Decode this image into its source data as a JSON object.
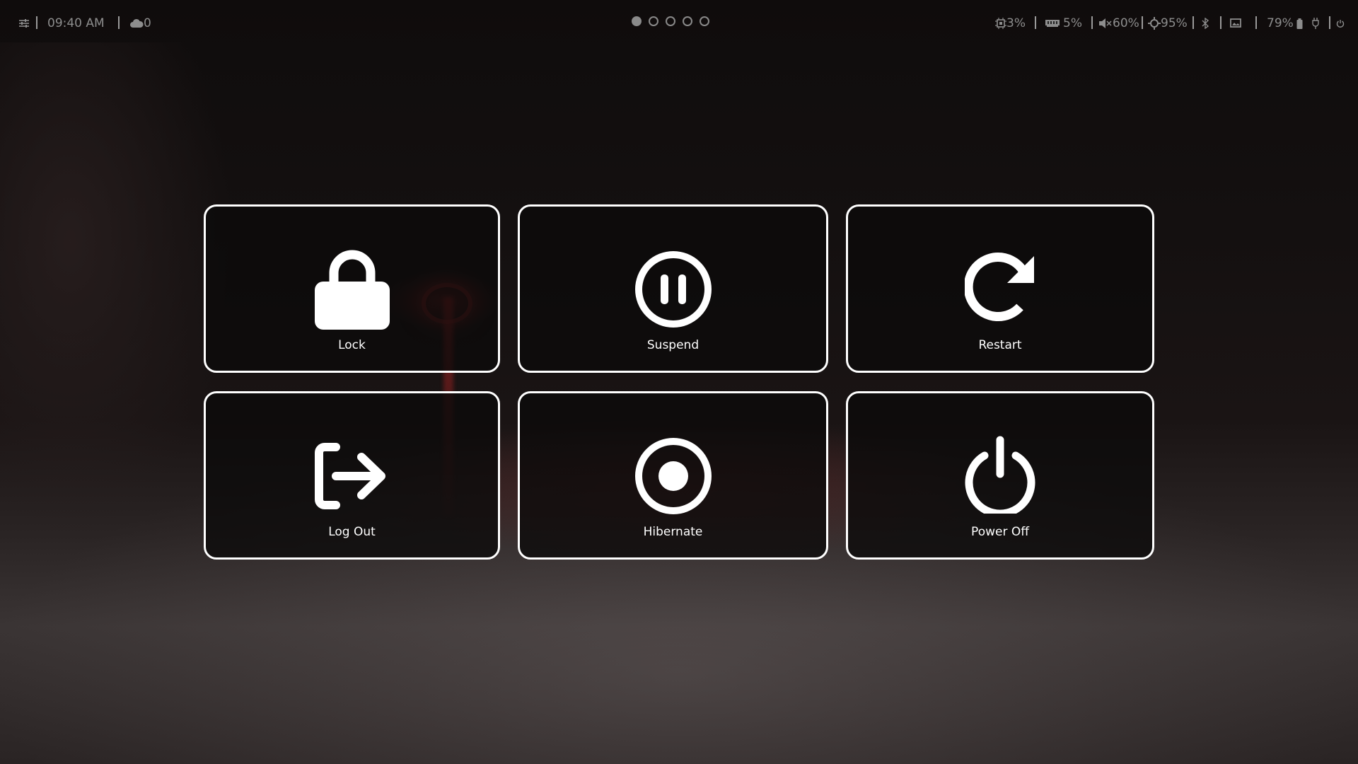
{
  "topbar": {
    "menu_icon": "sliders-icon",
    "time": "09:40 AM",
    "weather_icon": "cloud-icon",
    "weather_value": "0",
    "workspaces": [
      {
        "active": true
      },
      {
        "active": false
      },
      {
        "active": false
      },
      {
        "active": false
      },
      {
        "active": false
      }
    ],
    "cpu_icon": "cpu-icon",
    "cpu": "3%",
    "ram_icon": "memory-icon",
    "ram": "5%",
    "volume_icon": "volume-muted-icon",
    "volume": "60%",
    "brightness_icon": "brightness-icon",
    "brightness": "95%",
    "bluetooth_icon": "bluetooth-icon",
    "screenshot_icon": "screen-icon",
    "battery": "79%",
    "battery_icon": "battery-icon",
    "plug_icon": "plug-icon",
    "power_icon": "power-icon"
  },
  "actions": {
    "lock": {
      "label": "Lock",
      "icon": "lock-icon"
    },
    "suspend": {
      "label": "Suspend",
      "icon": "pause-circle-icon"
    },
    "restart": {
      "label": "Restart",
      "icon": "restart-icon"
    },
    "logout": {
      "label": "Log Out",
      "icon": "logout-icon"
    },
    "hibernate": {
      "label": "Hibernate",
      "icon": "record-circle-icon"
    },
    "poweroff": {
      "label": "Power Off",
      "icon": "power-icon"
    }
  },
  "colors": {
    "tile_border": "#ffffff",
    "tile_bg": "#0c0a0a",
    "bar_text": "#8d8d8d"
  }
}
